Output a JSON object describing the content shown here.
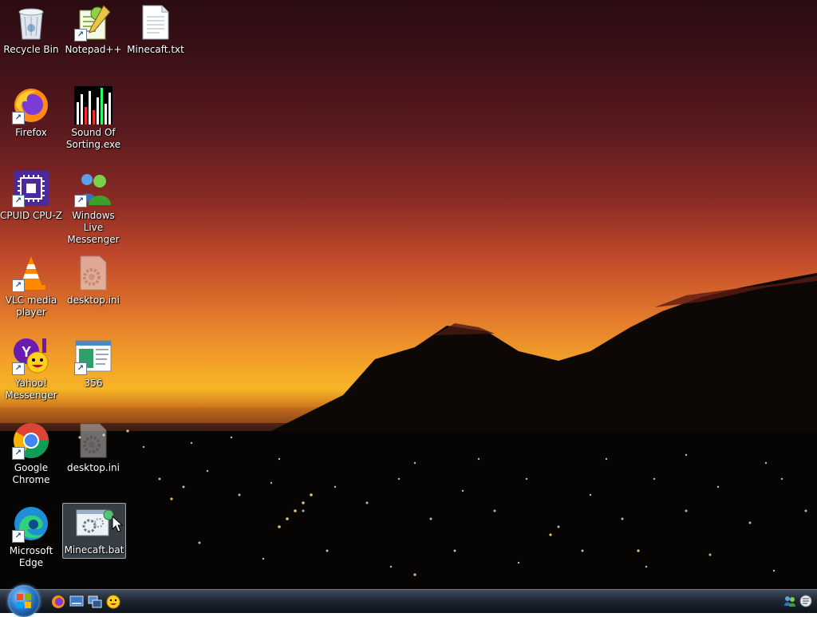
{
  "desktop": {
    "icons": [
      {
        "label": "Recycle Bin"
      },
      {
        "label": "Notepad++"
      },
      {
        "label": "Minecaft.txt"
      },
      {
        "label": "Firefox"
      },
      {
        "label": "Sound Of Sorting.exe"
      },
      {
        "label": "CPUID CPU-Z"
      },
      {
        "label": "Windows Live Messenger"
      },
      {
        "label": "VLC media player"
      },
      {
        "label": "desktop.ini"
      },
      {
        "label": "Yahoo! Messenger"
      },
      {
        "label": "356"
      },
      {
        "label": "Google Chrome"
      },
      {
        "label": "desktop.ini"
      },
      {
        "label": "Microsoft Edge"
      },
      {
        "label": "Minecaft.bat"
      }
    ],
    "selected_icon": "Minecaft.bat"
  },
  "taskbar": {
    "quick_launch": [
      "firefox-icon",
      "show-desktop-icon",
      "switch-windows-icon",
      "yahoo-messenger-icon"
    ],
    "tray": [
      "messenger-status-icon",
      "messenger-icon"
    ]
  },
  "colors": {
    "taskbar": "#1f2732",
    "sky_top": "#2a0c12",
    "sky_horizon": "#f7b526"
  }
}
